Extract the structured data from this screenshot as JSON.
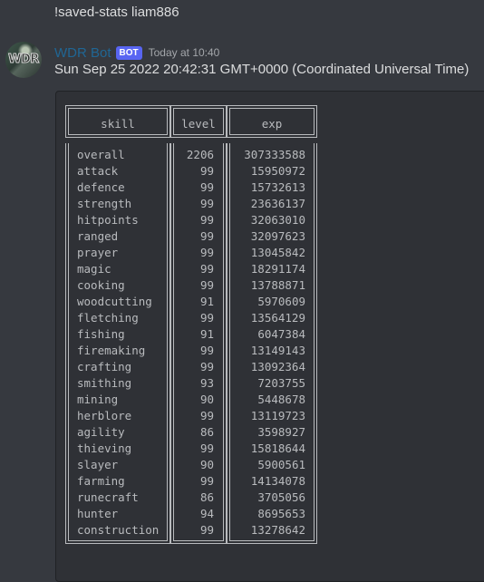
{
  "command_message": {
    "text": "!saved-stats liam886"
  },
  "bot_message": {
    "avatar_label": "WDR",
    "username": "WDR Bot",
    "badge": "BOT",
    "timestamp": "Today at 10:40",
    "text": "Sun Sep 25 2022 20:42:31 GMT+0000 (Coordinated Universal Time)"
  },
  "table": {
    "headers": [
      "skill",
      "level",
      "exp"
    ],
    "rows": [
      [
        "overall",
        "2206",
        "307333588"
      ],
      [
        "attack",
        "99",
        "15950972"
      ],
      [
        "defence",
        "99",
        "15732613"
      ],
      [
        "strength",
        "99",
        "23636137"
      ],
      [
        "hitpoints",
        "99",
        "32063010"
      ],
      [
        "ranged",
        "99",
        "32097623"
      ],
      [
        "prayer",
        "99",
        "13045842"
      ],
      [
        "magic",
        "99",
        "18291174"
      ],
      [
        "cooking",
        "99",
        "13788871"
      ],
      [
        "woodcutting",
        "91",
        "5970609"
      ],
      [
        "fletching",
        "99",
        "13564129"
      ],
      [
        "fishing",
        "91",
        "6047384"
      ],
      [
        "firemaking",
        "99",
        "13149143"
      ],
      [
        "crafting",
        "99",
        "13092364"
      ],
      [
        "smithing",
        "93",
        "7203755"
      ],
      [
        "mining",
        "90",
        "5448678"
      ],
      [
        "herblore",
        "99",
        "13119723"
      ],
      [
        "agility",
        "86",
        "3598927"
      ],
      [
        "thieving",
        "99",
        "15818644"
      ],
      [
        "slayer",
        "90",
        "5900561"
      ],
      [
        "farming",
        "99",
        "14134078"
      ],
      [
        "runecraft",
        "86",
        "3705056"
      ],
      [
        "hunter",
        "94",
        "8695653"
      ],
      [
        "construction",
        "99",
        "13278642"
      ]
    ]
  }
}
